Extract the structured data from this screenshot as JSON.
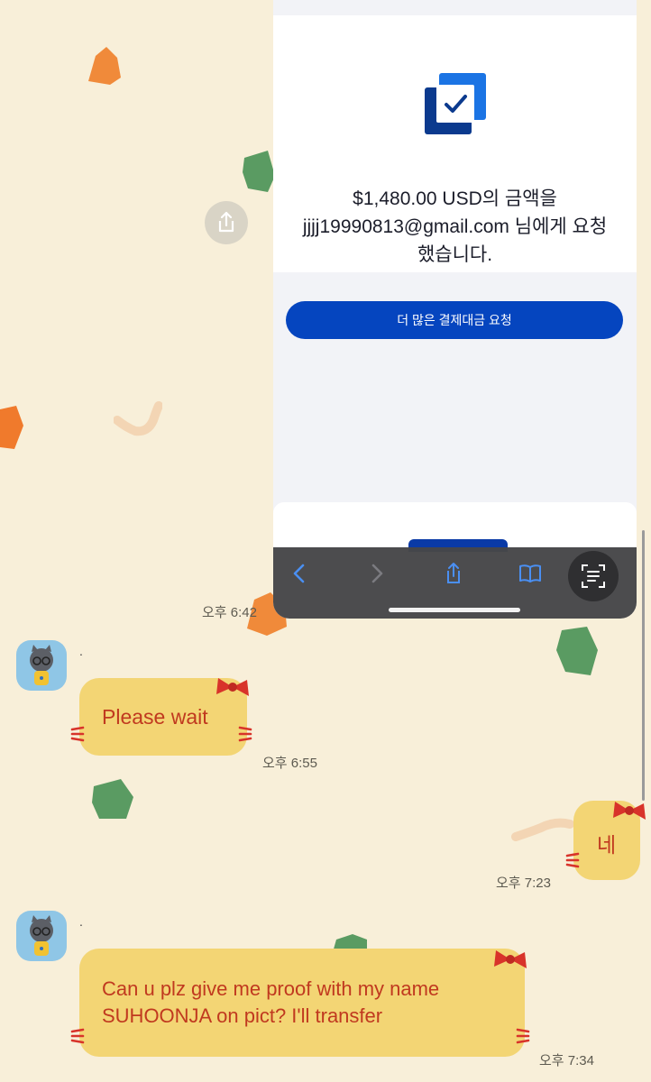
{
  "screenshot": {
    "request_line1": "$1,480.00 USD의 금액을",
    "request_line2": "jjjj19990813@gmail.com 님에게 요청",
    "request_line3": "했습니다.",
    "more_requests_button": "더 많은 결제대금 요청",
    "toolbar_icons": [
      "back-icon",
      "forward-icon",
      "share-icon",
      "bookmarks-icon",
      "text-scan-icon"
    ]
  },
  "chat": {
    "messages": [
      {
        "direction": "out",
        "time": "오후 6:42"
      },
      {
        "direction": "in",
        "sender": ".",
        "text": "Please wait",
        "time": "오후 6:55"
      },
      {
        "direction": "out",
        "text": "네",
        "time": "오후 7:23"
      },
      {
        "direction": "in",
        "sender": ".",
        "text_line1": "Can u plz give me proof with my name",
        "text_line2": "SUHOONJA on pict? I'll transfer",
        "time": "오후 7:34"
      }
    ]
  },
  "colors": {
    "chat_background": "#f8efd9",
    "bubble": "#f3d574",
    "bubble_text": "#c0391f",
    "paypal_button": "#0545bf"
  }
}
